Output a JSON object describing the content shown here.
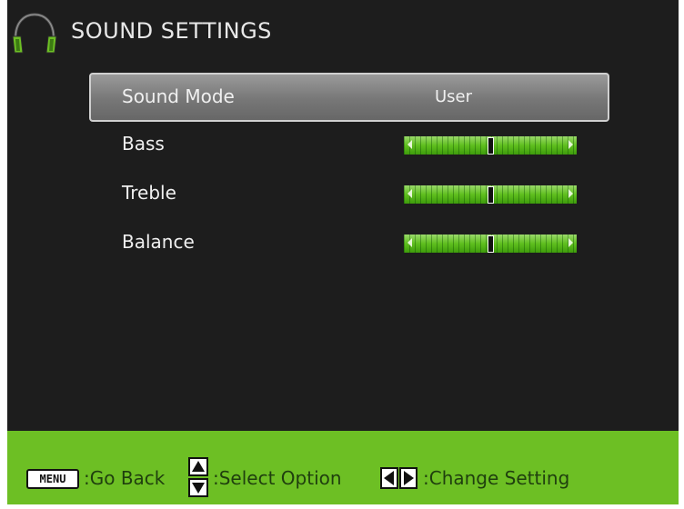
{
  "header": {
    "title": "SOUND SETTINGS",
    "icon": "headphones-icon"
  },
  "menu": {
    "items": [
      {
        "label": "Sound Mode",
        "value": "User",
        "type": "option",
        "selected": true
      },
      {
        "label": "Bass",
        "type": "slider",
        "level": 0.5
      },
      {
        "label": "Treble",
        "type": "slider",
        "level": 0.5
      },
      {
        "label": "Balance",
        "type": "slider",
        "level": 0.5
      }
    ]
  },
  "footer": {
    "menu_key": "MENU",
    "go_back": ":Go Back",
    "select_option": ":Select Option",
    "change_setting": ":Change Setting"
  },
  "colors": {
    "background": "#1d1d1d",
    "accent_green": "#6dbf24",
    "selected_row": "#888888"
  }
}
